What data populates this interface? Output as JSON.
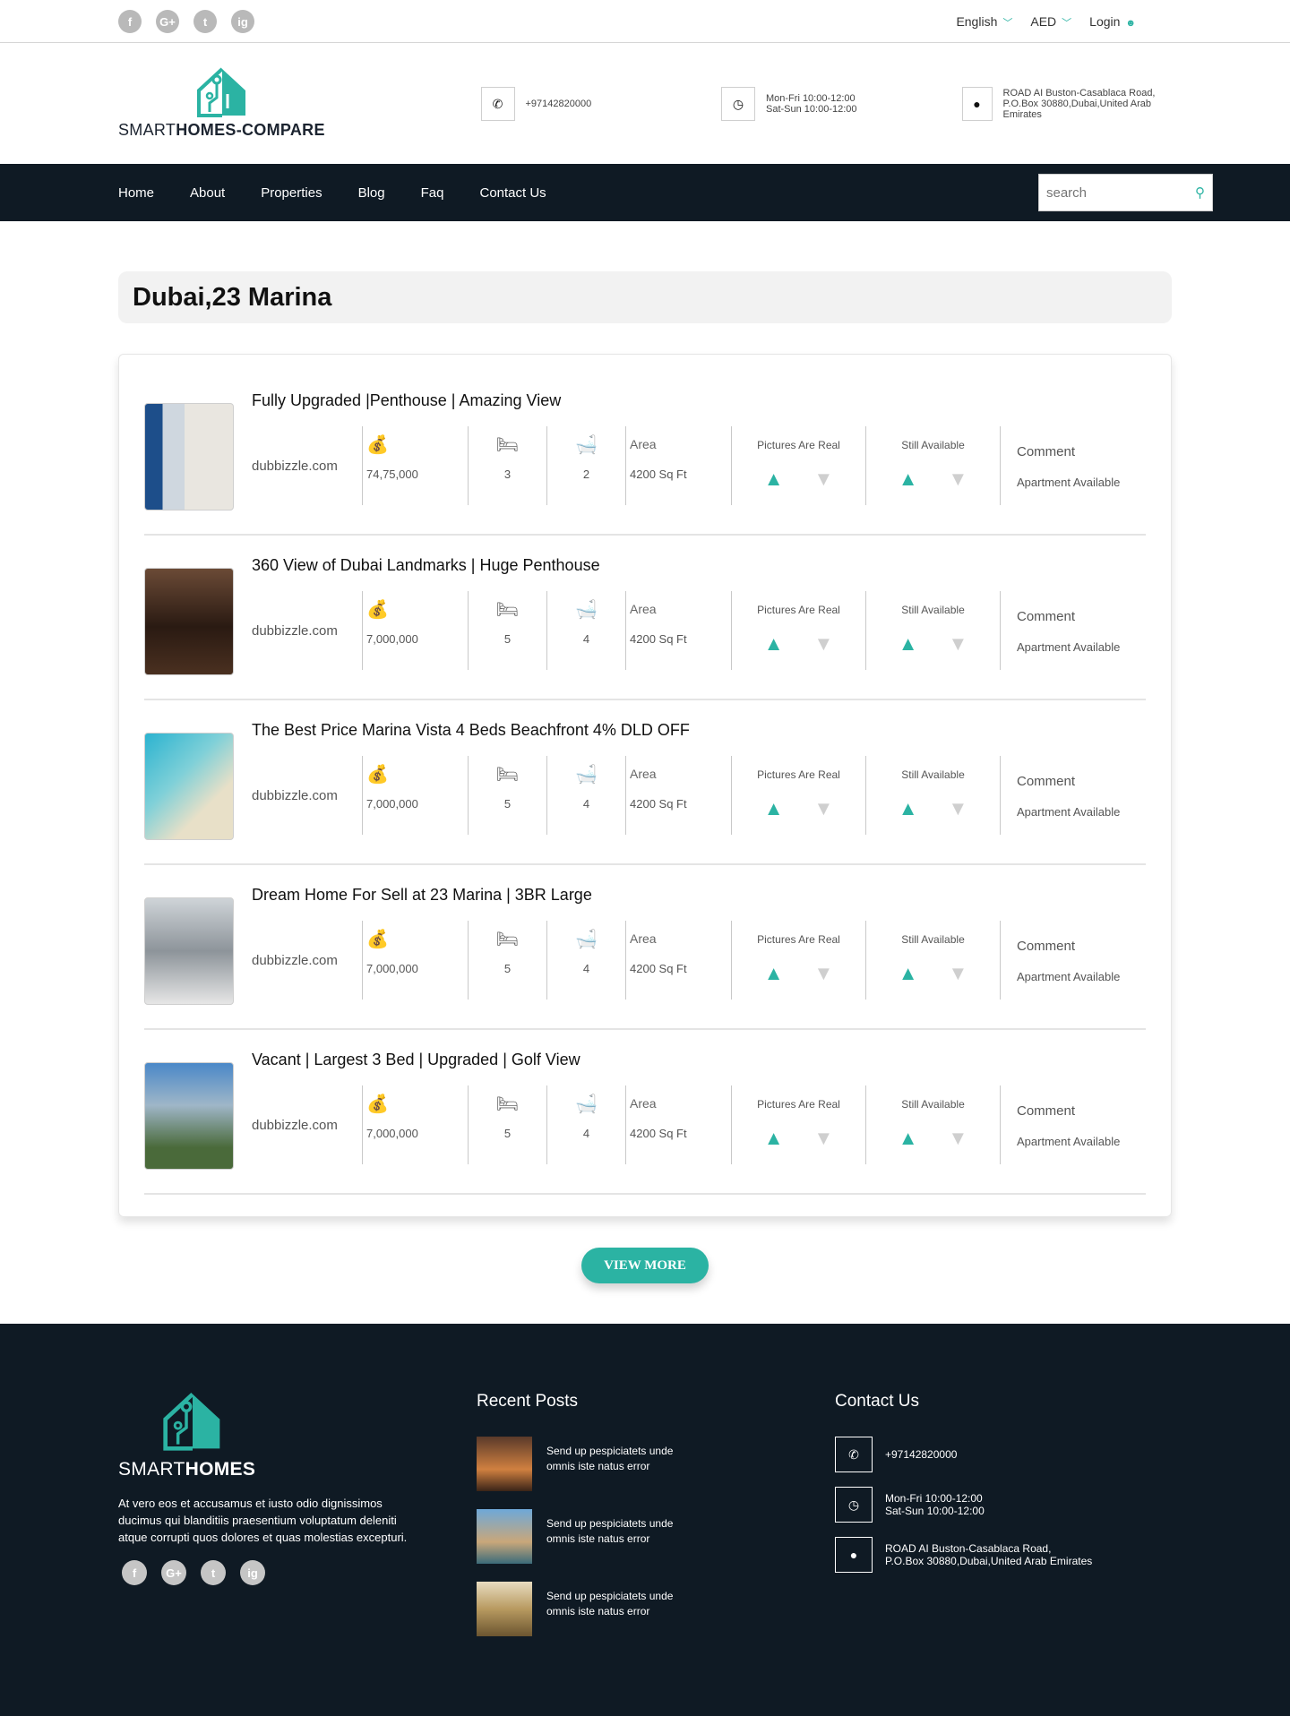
{
  "topbar": {
    "social": [
      "f",
      "G+",
      "t",
      "ig"
    ],
    "language": "English",
    "currency": "AED",
    "login": "Login"
  },
  "header": {
    "logo_light": "SMART",
    "logo_bold": "HOMES-COMPARE",
    "phone": "+97142820000",
    "hours_1": "Mon-Fri 10:00-12:00",
    "hours_2": "Sat-Sun 10:00-12:00",
    "address_1": "ROAD AI Buston-Casablaca Road,",
    "address_2": "P.O.Box 30880,Dubai,United Arab Emirates"
  },
  "nav": {
    "items": [
      "Home",
      "About",
      "Properties",
      "Blog",
      "Faq",
      "Contact Us"
    ],
    "search_placeholder": "search"
  },
  "page_title": "Dubai,23 Marina",
  "labels": {
    "area": "Area",
    "pictures_real": "Pictures Are Real",
    "still_available": "Still Available",
    "comment": "Comment",
    "comment_text": "Apartment Available"
  },
  "listings": [
    {
      "title": "Fully Upgraded |Penthouse | Amazing View",
      "source": "dubbizzle.com",
      "price": "74,75,000",
      "beds": "3",
      "baths": "2",
      "area": "4200 Sq Ft"
    },
    {
      "title": "360 View of Dubai Landmarks | Huge Penthouse",
      "source": "dubbizzle.com",
      "price": "7,000,000",
      "beds": "5",
      "baths": "4",
      "area": "4200 Sq Ft"
    },
    {
      "title": "The Best Price Marina Vista 4 Beds Beachfront 4% DLD OFF",
      "source": "dubbizzle.com",
      "price": "7,000,000",
      "beds": "5",
      "baths": "4",
      "area": "4200 Sq Ft"
    },
    {
      "title": "Dream Home For Sell at 23 Marina | 3BR Large",
      "source": "dubbizzle.com",
      "price": "7,000,000",
      "beds": "5",
      "baths": "4",
      "area": "4200 Sq Ft"
    },
    {
      "title": "Vacant | Largest 3 Bed | Upgraded | Golf View",
      "source": "dubbizzle.com",
      "price": "7,000,000",
      "beds": "5",
      "baths": "4",
      "area": "4200 Sq Ft"
    }
  ],
  "view_more": "VIEW MORE",
  "footer": {
    "logo_light": "SMART",
    "logo_bold": "HOMES",
    "description": "At vero eos et accusamus et iusto odio dignissimos ducimus qui blanditiis praesentium voluptatum deleniti atque corrupti quos dolores et quas molestias excepturi.",
    "recent_posts_title": "Recent Posts",
    "posts": [
      {
        "line1": "Send up pespiciatets unde",
        "line2": "omnis iste natus error"
      },
      {
        "line1": "Send up pespiciatets unde",
        "line2": "omnis iste natus error"
      },
      {
        "line1": "Send up pespiciatets unde",
        "line2": "omnis iste natus error"
      }
    ],
    "contact_title": "Contact Us",
    "phone": "+97142820000",
    "hours_1": "Mon-Fri 10:00-12:00",
    "hours_2": "Sat-Sun 10:00-12:00",
    "address_1": "ROAD AI Buston-Casablaca Road,",
    "address_2": "P.O.Box 30880,Dubai,United Arab Emirates"
  },
  "colors": {
    "accent": "#2bb3a3",
    "dark": "#0f1a24"
  }
}
